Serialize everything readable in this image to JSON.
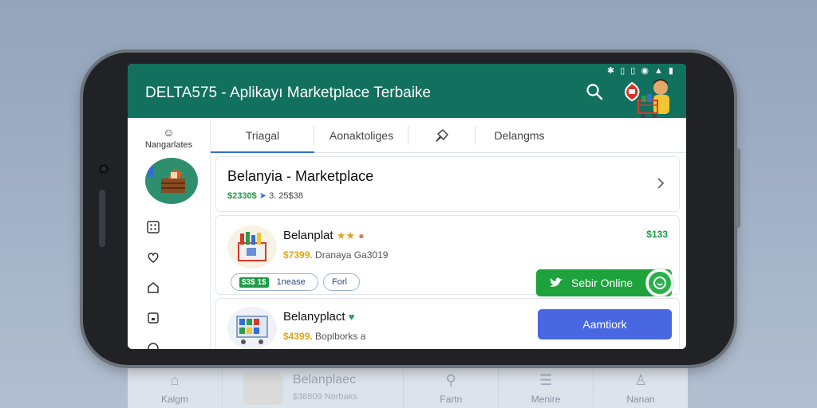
{
  "app": {
    "title": "DELTA575 - Aplikayı Marketplace Terbaike",
    "status_icons": "✱ ▯ ▯ ◉ ▲ ▮"
  },
  "sidebar": {
    "header_label": "Nangarlates"
  },
  "tabs": [
    {
      "label": "Triagal",
      "active": true
    },
    {
      "label": "Aonaktoliges",
      "active": false
    },
    {
      "label": "",
      "icon": "pin-icon",
      "active": false
    },
    {
      "label": "Delangms",
      "active": false
    }
  ],
  "featured": {
    "title": "Belanyia - Marketplace",
    "price": "$2330$",
    "meta": "3. 25$38"
  },
  "items": [
    {
      "title": "Belanplat",
      "rating": "$7399.",
      "desc": "Dranaya Ga3019",
      "price": "$133",
      "pill_badge": "$3$ 1$",
      "pill_text": "1nease",
      "pill2_text": "Forl"
    },
    {
      "title": "Belanyplact",
      "rating": "$4399.",
      "desc": "Boplborks a"
    }
  ],
  "buttons": {
    "online": "Sebir Online",
    "amount": "Aamtiork"
  },
  "bottom_nav": {
    "home": "Kalgm",
    "product_title": "Belanplaec",
    "product_sub": "$38809 Norbaks",
    "search": "Fartn",
    "menu": "Menire",
    "profile": "Nanan"
  },
  "colors": {
    "appbar": "#12705e",
    "accent_blue": "#2f6fd6",
    "green": "#1ea23c",
    "button_blue": "#4a67e2"
  }
}
